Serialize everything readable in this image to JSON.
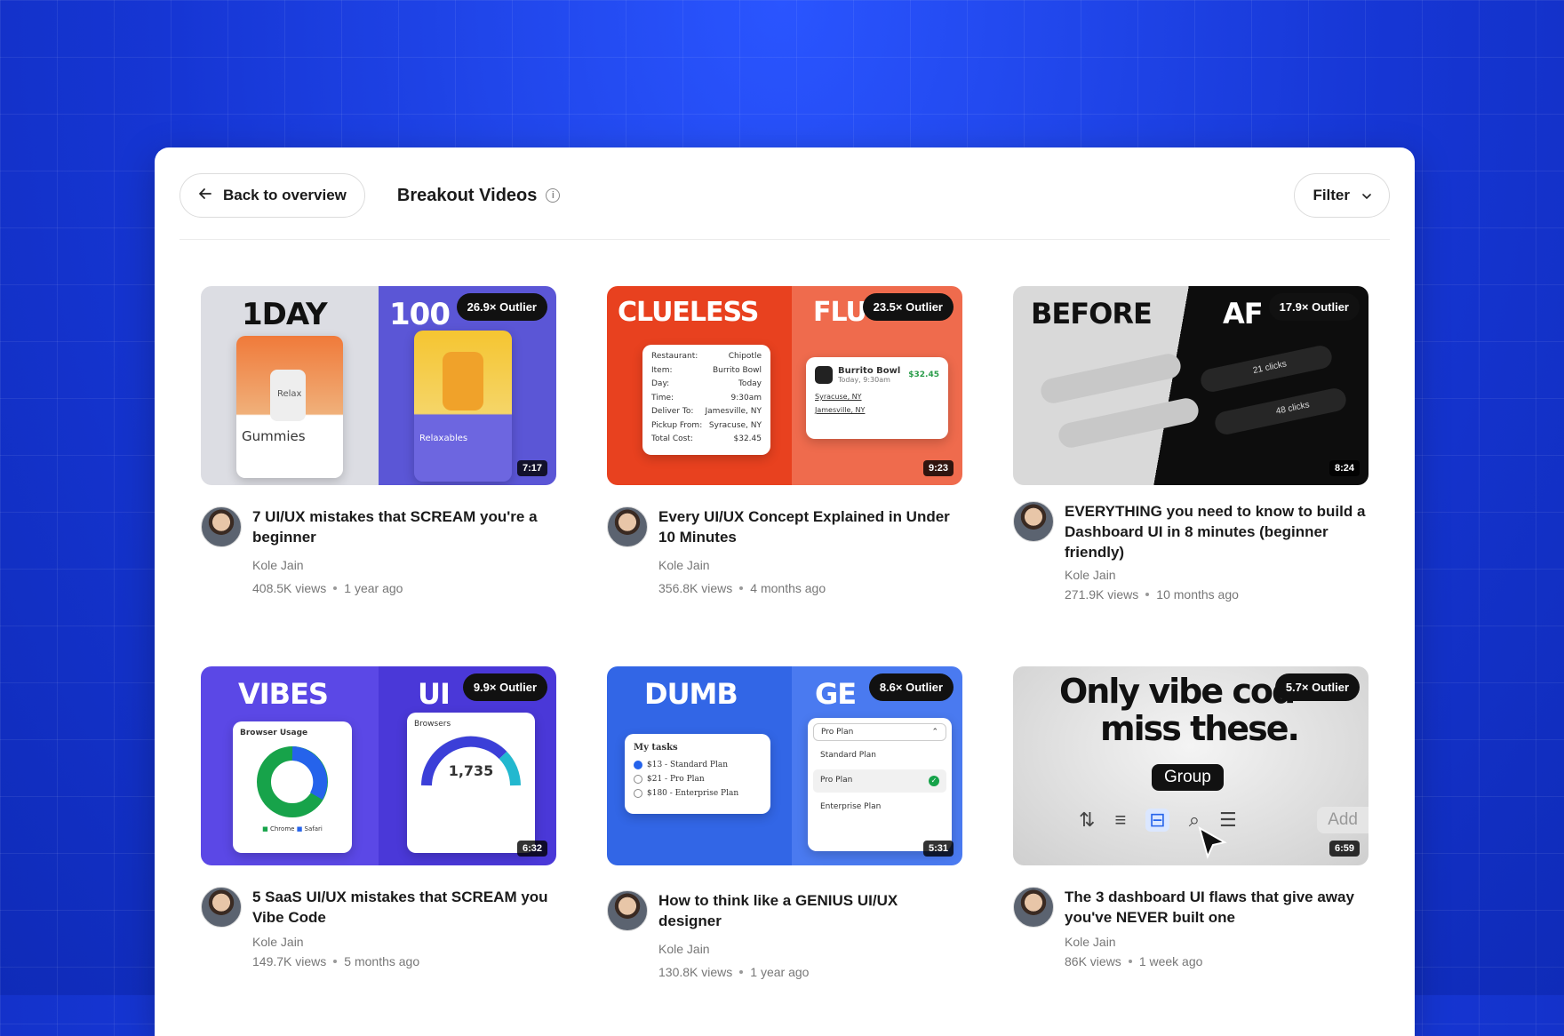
{
  "header": {
    "back_label": "Back to overview",
    "title": "Breakout Videos",
    "filter_label": "Filter"
  },
  "videos": [
    {
      "word_left": "1DAY",
      "word_right": "100",
      "outlier": "26.9× Outlier",
      "duration": "7:17",
      "title": "7 UI/UX mistakes that SCREAM you're a beginner",
      "channel": "Kole Jain",
      "views": "408.5K views",
      "age": "1 year ago"
    },
    {
      "word_left": "CLUELESS",
      "word_right": "FLU",
      "outlier": "23.5× Outlier",
      "duration": "9:23",
      "title": "Every UI/UX Concept Explained in Under 10 Minutes",
      "channel": "Kole Jain",
      "views": "356.8K views",
      "age": "4 months ago"
    },
    {
      "word_left": "BEFORE",
      "word_right": "AF",
      "outlier": "17.9× Outlier",
      "duration": "8:24",
      "title": "EVERYTHING you need to know to build a Dashboard UI in 8 minutes (beginner friendly)",
      "channel": "Kole Jain",
      "views": "271.9K views",
      "age": "10 months ago"
    },
    {
      "word_left": "VIBES",
      "word_right": "UI",
      "outlier": "9.9× Outlier",
      "duration": "6:32",
      "title": "5 SaaS UI/UX mistakes that SCREAM you Vibe Code",
      "channel": "Kole Jain",
      "views": "149.7K views",
      "age": "5 months ago"
    },
    {
      "word_left": "DUMB",
      "word_right": "GE",
      "outlier": "8.6× Outlier",
      "duration": "5:31",
      "title": "How to think like a GENIUS UI/UX designer",
      "channel": "Kole Jain",
      "views": "130.8K views",
      "age": "1 year ago"
    },
    {
      "word_left": "Only vibe cod",
      "word_right": "miss these.",
      "outlier": "5.7× Outlier",
      "duration": "6:59",
      "title": "The 3 dashboard UI flaws that give away you've NEVER built one",
      "channel": "Kole Jain",
      "views": "86K views",
      "age": "1 week ago"
    }
  ],
  "thumb_mock": {
    "gummies": "Gummies",
    "relax": "Relax",
    "relaxables": "Relaxables",
    "receipt": [
      [
        "Restaurant:",
        "Chipotle"
      ],
      [
        "Item:",
        "Burrito Bowl"
      ],
      [
        "Day:",
        "Today"
      ],
      [
        "Time:",
        "9:30am"
      ],
      [
        "Deliver To:",
        "Jamesville, NY"
      ],
      [
        "Pickup From:",
        "Syracuse, NY"
      ],
      [
        "Total Cost:",
        "$32.45"
      ]
    ],
    "order_title": "Burrito Bowl",
    "order_sub": "Today, 9:30am",
    "order_price": "$32.45",
    "order_loc1": "Syracuse, NY",
    "order_loc2": "Jamesville, NY",
    "clicks1": "21 clicks",
    "clicks2": "48 clicks",
    "browser_usage": "Browser Usage",
    "browsers": "Browsers",
    "big_num": "1,735",
    "legend_chrome": "Chrome",
    "legend_safari": "Safari",
    "tasks_title": "My tasks",
    "tasks": [
      "$13 - Standard Plan",
      "$21 - Pro Plan",
      "$180 - Enterprise Plan"
    ],
    "plan_select": "Pro Plan",
    "plans": [
      "Standard Plan",
      "Pro Plan",
      "Enterprise Plan"
    ],
    "group": "Group",
    "add": "Add"
  }
}
